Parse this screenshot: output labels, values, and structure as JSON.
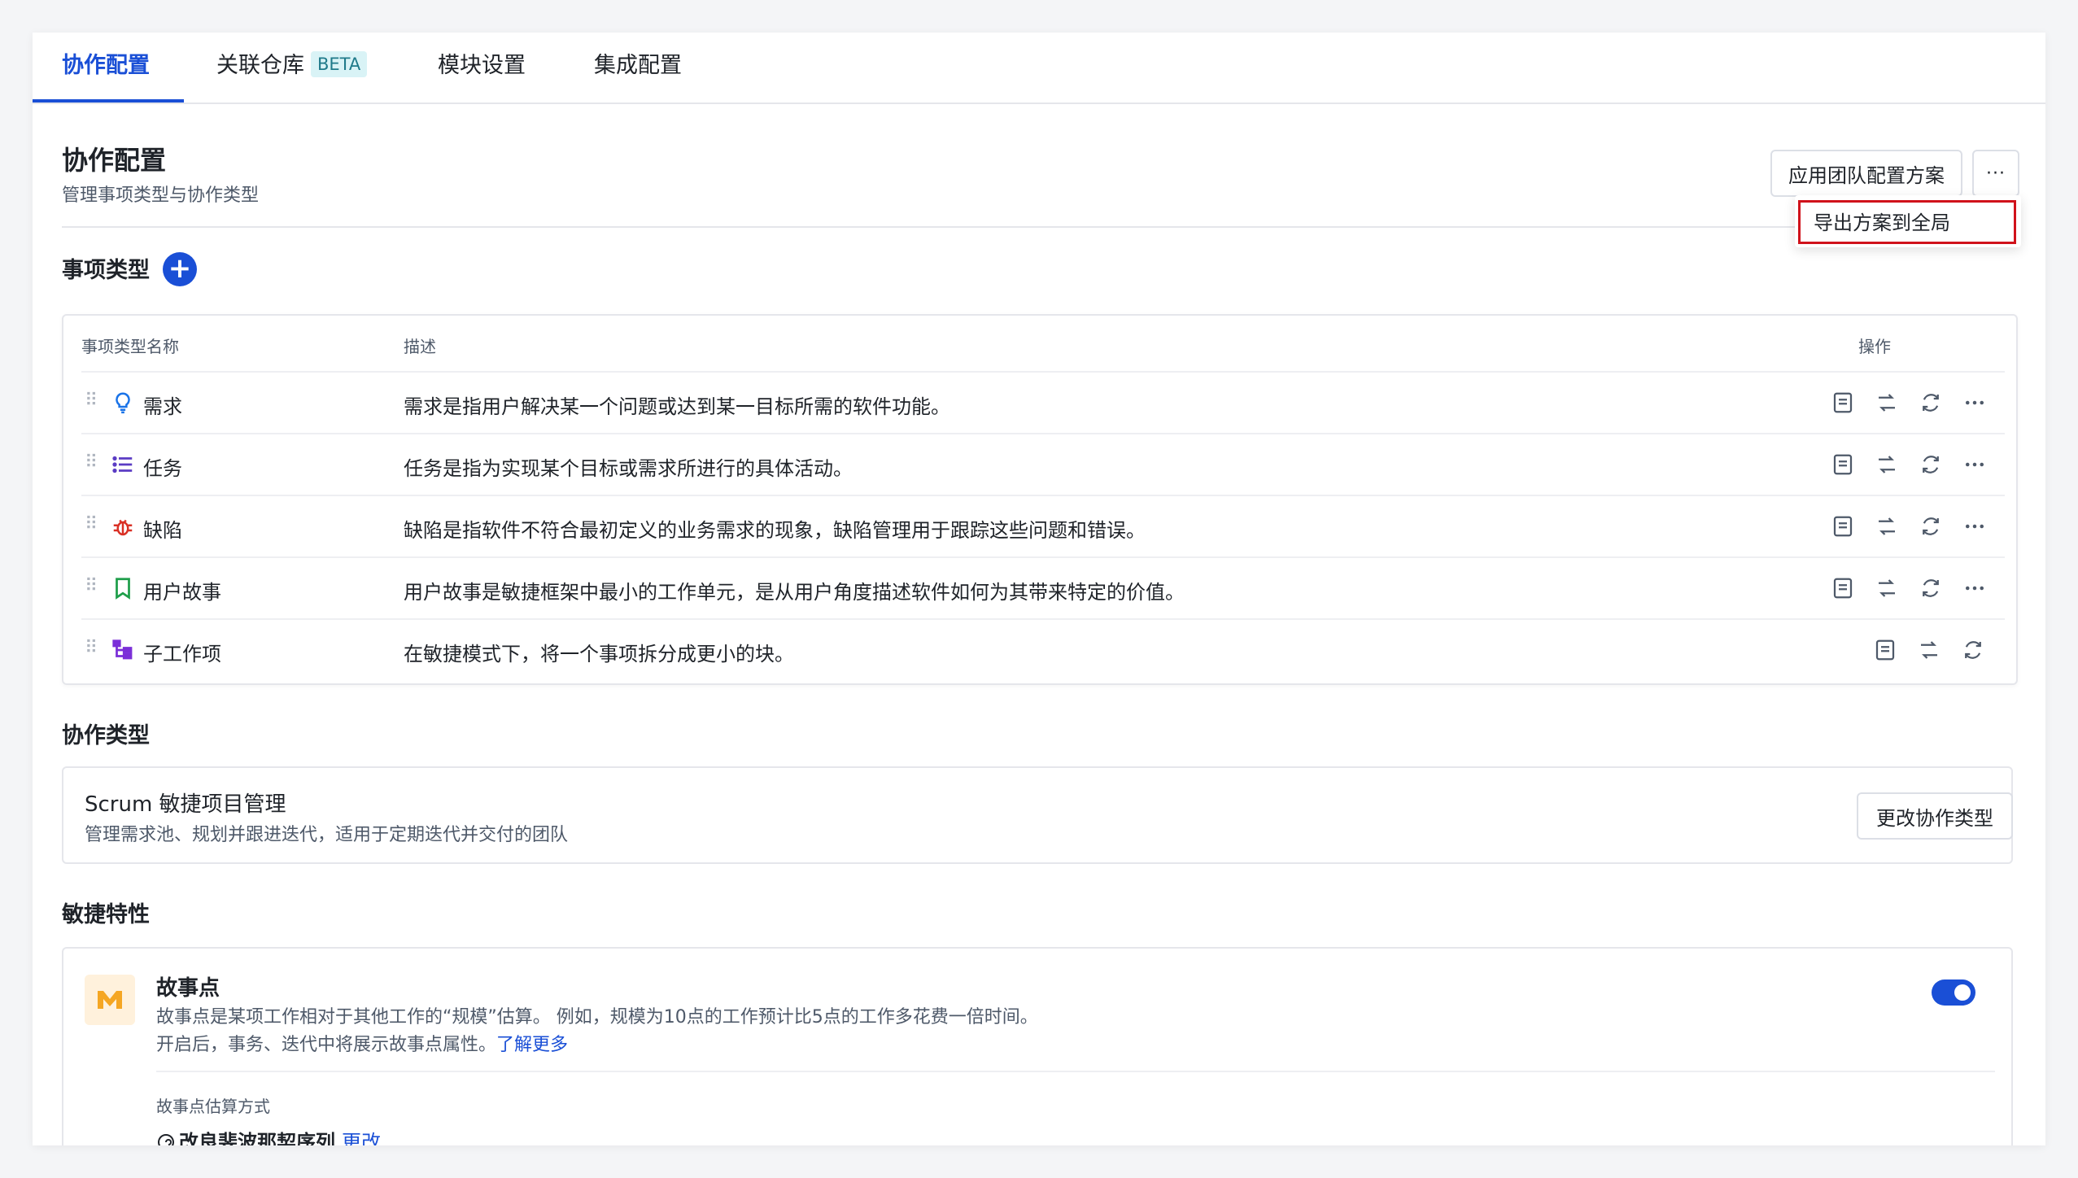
{
  "tabs": [
    {
      "label": "协作配置",
      "active": true
    },
    {
      "label": "关联仓库",
      "badge": "BETA"
    },
    {
      "label": "模块设置"
    },
    {
      "label": "集成配置"
    }
  ],
  "header": {
    "title": "协作配置",
    "subtitle": "管理事项类型与协作类型",
    "apply_label": "应用团队配置方案",
    "more_label": "···",
    "dropdown_item": "导出方案到全局"
  },
  "issue_types": {
    "title": "事项类型",
    "add_label": "+",
    "columns": {
      "name": "事项类型名称",
      "desc": "描述",
      "ops": "操作"
    },
    "rows": [
      {
        "name": "需求",
        "icon": "lightbulb-icon",
        "color": "#1a73e8",
        "desc": "需求是指用户解决某一个问题或达到某一目标所需的软件功能。"
      },
      {
        "name": "任务",
        "icon": "list-icon",
        "color": "#5b3cc4",
        "desc": "任务是指为实现某个目标或需求所进行的具体活动。"
      },
      {
        "name": "缺陷",
        "icon": "bug-icon",
        "color": "#d93025",
        "desc": "缺陷是指软件不符合最初定义的业务需求的现象，缺陷管理用于跟踪这些问题和错误。"
      },
      {
        "name": "用户故事",
        "icon": "bookmark-icon",
        "color": "#1e9e4a",
        "desc": "用户故事是敏捷框架中最小的工作单元，是从用户角度描述软件如何为其带来特定的价值。"
      },
      {
        "name": "子工作项",
        "icon": "subtask-icon",
        "color": "#7b2fd8",
        "desc": "在敏捷模式下，将一个事项拆分成更小的块。"
      }
    ]
  },
  "collab": {
    "title": "协作类型",
    "name": "Scrum 敏捷项目管理",
    "desc": "管理需求池、规划并跟进迭代，适用于定期迭代并交付的团队",
    "change_label": "更改协作类型"
  },
  "agile": {
    "title": "敏捷特性",
    "sp_title": "故事点",
    "sp_desc1": "故事点是某项工作相对于其他工作的“规模”估算。 例如，规模为10点的工作预计比5点的工作多花费一倍时间。",
    "sp_desc2": "开启后，事务、迭代中将展示故事点属性。",
    "learn_more": "了解更多",
    "toggle_on": true,
    "method_label": "故事点估算方式",
    "method_value": "改良斐波那契序列",
    "change_label": "更改"
  },
  "colors": {
    "accent": "#1a4fd6",
    "highlight": "#d0121b",
    "sp_icon": "#f5a623"
  }
}
